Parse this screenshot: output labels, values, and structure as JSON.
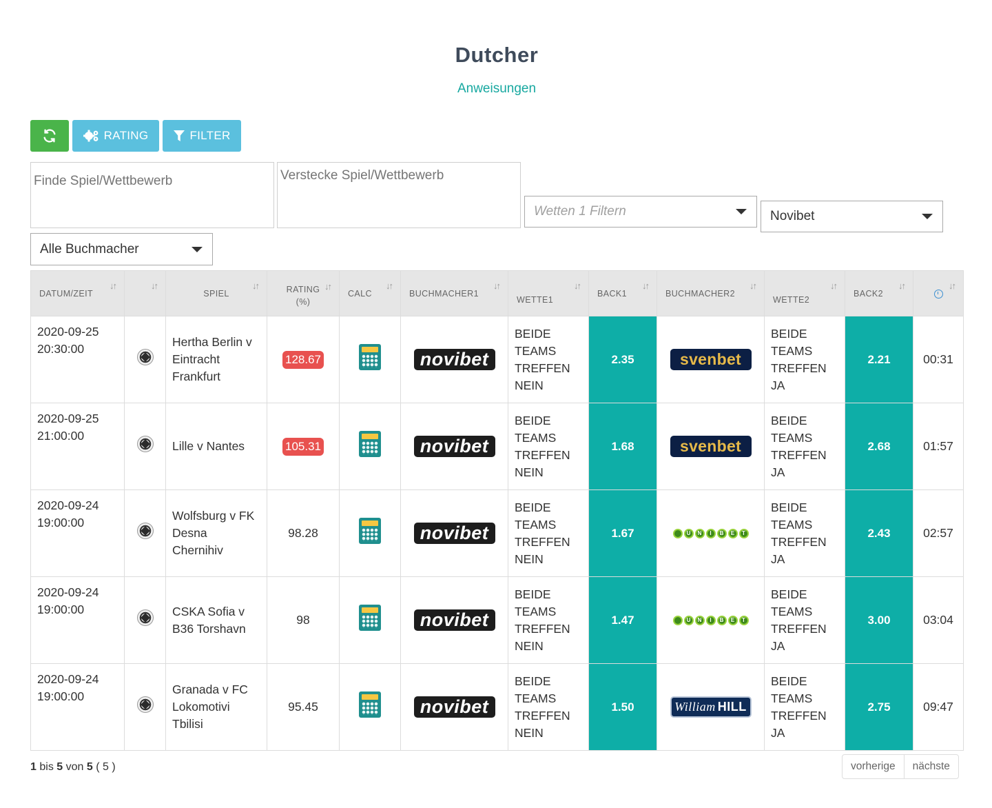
{
  "header": {
    "title": "Dutcher",
    "instructions_link": "Anweisungen"
  },
  "toolbar": {
    "refresh_icon": "refresh-icon",
    "rating_label": "RATING",
    "filter_label": "FILTER"
  },
  "search": {
    "find_placeholder": "Finde Spiel/Wettbewerb",
    "hide_placeholder": "Verstecke Spiel/Wettbewerb"
  },
  "filters": {
    "bet_filter_placeholder": "Wetten 1 Filtern",
    "bookmaker2_selected": "Novibet",
    "bookmaker_selected": "Alle Buchmacher"
  },
  "table": {
    "headers": {
      "datetime": "DATUM/ZEIT",
      "match": "SPIEL",
      "rating": "RATING",
      "rating_unit": "(%)",
      "calc": "CALC",
      "bookmaker1": "BUCHMACHER1",
      "bet1": "WETTE1",
      "back1": "BACK1",
      "bookmaker2": "BUCHMACHER2",
      "bet2": "WETTE2",
      "back2": "BACK2",
      "sort_icon": "↓↑"
    },
    "rows": [
      {
        "date": "2020-09-25",
        "time": "20:30:00",
        "match": "Hertha Berlin v Eintracht Frankfurt",
        "rating": "128.67",
        "bookmaker1": "novibet",
        "bet1": "BEIDE TEAMS TREFFEN NEIN",
        "back1": "2.35",
        "bookmaker2": "svenbet",
        "bet2": "BEIDE TEAMS TREFFEN JA",
        "back2": "2.21",
        "elapsed": "00:31"
      },
      {
        "date": "2020-09-25",
        "time": "21:00:00",
        "match": "Lille v Nantes",
        "rating": "105.31",
        "bookmaker1": "novibet",
        "bet1": "BEIDE TEAMS TREFFEN NEIN",
        "back1": "1.68",
        "bookmaker2": "svenbet",
        "bet2": "BEIDE TEAMS TREFFEN JA",
        "back2": "2.68",
        "elapsed": "01:57"
      },
      {
        "date": "2020-09-24",
        "time": "19:00:00",
        "match": "Wolfsburg v FK Desna Chernihiv",
        "rating": "98.28",
        "bookmaker1": "novibet",
        "bet1": "BEIDE TEAMS TREFFEN NEIN",
        "back1": "1.67",
        "bookmaker2": "UNIBET",
        "bet2": "BEIDE TEAMS TREFFEN JA",
        "back2": "2.43",
        "elapsed": "02:57"
      },
      {
        "date": "2020-09-24",
        "time": "19:00:00",
        "match": "CSKA Sofia v B36 Torshavn",
        "rating": "98",
        "bookmaker1": "novibet",
        "bet1": "BEIDE TEAMS TREFFEN NEIN",
        "back1": "1.47",
        "bookmaker2": "UNIBET",
        "bet2": "BEIDE TEAMS TREFFEN JA",
        "back2": "3.00",
        "elapsed": "03:04"
      },
      {
        "date": "2020-09-24",
        "time": "19:00:00",
        "match": "Granada v FC Lokomotivi Tbilisi",
        "rating": "95.45",
        "bookmaker1": "novibet",
        "bet1": "BEIDE TEAMS TREFFEN NEIN",
        "back1": "1.50",
        "bookmaker2": "William HILL",
        "bet2": "BEIDE TEAMS TREFFEN JA",
        "back2": "2.75",
        "elapsed": "09:47"
      }
    ]
  },
  "pagination": {
    "from": "1",
    "bis": "bis",
    "to": "5",
    "von": "von",
    "total": "5",
    "filtered": "( 5 )",
    "prev_label": "vorherige",
    "next_label": "nächste"
  },
  "colors": {
    "accent": "#0eaea7",
    "refresh_button": "#4ab44a",
    "info_button": "#5bc0de",
    "rating_badge": "#e8514f",
    "title": "#3f4b5b"
  }
}
